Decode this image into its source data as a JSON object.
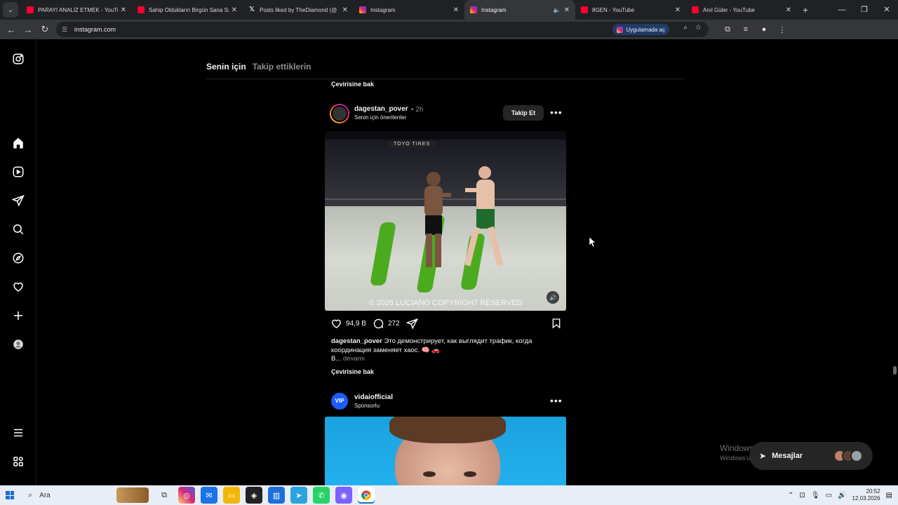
{
  "browser": {
    "tabs": [
      {
        "title": "PARAYI ANALİZ ETMEK - YouTube",
        "favicon": "youtube-icon",
        "active": false
      },
      {
        "title": "Sahip Oldukların Birgün Sana Sahip",
        "favicon": "youtube-icon",
        "active": false
      },
      {
        "title": "Posts liked by TheDiamond (@",
        "favicon": "x-icon",
        "active": false
      },
      {
        "title": "Instagram",
        "favicon": "instagram-icon",
        "active": false
      },
      {
        "title": "Instagram",
        "favicon": "instagram-icon",
        "active": true
      },
      {
        "title": "8GEN - YouTube",
        "favicon": "youtube-icon",
        "active": false
      },
      {
        "title": "Anıl Güler - YouTube",
        "favicon": "youtube-icon",
        "active": false
      }
    ],
    "url": "instagram.com",
    "open_in_app_label": "Uygulamada aç"
  },
  "instagram": {
    "feed_tabs": {
      "for_you": "Senin için",
      "following": "Takip ettiklerin"
    },
    "see_translation": "Çevirisine bak",
    "post1": {
      "username": "dagestan_pover",
      "time": "2h",
      "subtitle": "Senin için önerilenler",
      "follow_label": "Takip Et",
      "media_watermark": "© 2026 LUCIANO COPYRIGHT RESERVED",
      "media_brand": "TOYO TIRES",
      "likes": "94,9 B",
      "comments": "272",
      "caption_user": "dagestan_pover",
      "caption_text": "Это демонстрирует, как выглядит трафик, когда координация заменяет хаос. 🧠 🚗",
      "caption_tail": "B...",
      "caption_more": "devamı",
      "see_translation": "Çevirisine bak"
    },
    "post2": {
      "username": "vidaiofficial",
      "subtitle": "Sponsorlu",
      "avatar_text": "VIP"
    },
    "messages_label": "Mesajlar"
  },
  "windows": {
    "watermark_line1": "Windows'u Etkinleştir",
    "watermark_line2": "Windows'u etkinleştirmek için Ayarlar'a gidin.",
    "search_label": "Ara",
    "time": "20:52",
    "date": "12.03.2026"
  },
  "colors": {
    "instagram_bg": "#000000",
    "follow_button": "#262626",
    "taskbar": "#e9eef6",
    "chrome_dark": "#202124"
  }
}
